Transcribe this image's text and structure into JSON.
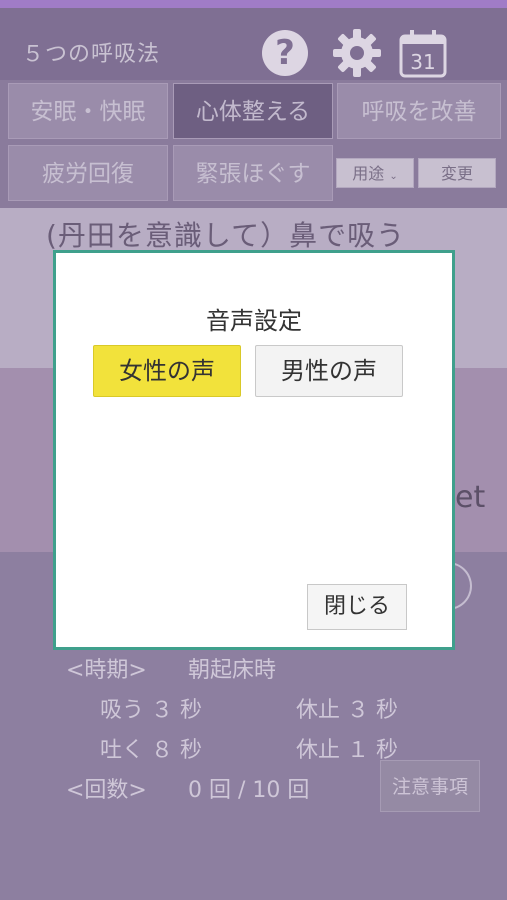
{
  "header": {
    "title": "５つの呼吸法",
    "calendar_day": "31"
  },
  "modes": {
    "row1": [
      "安眠・快眠",
      "心体整える",
      "呼吸を改善"
    ],
    "row2": [
      "疲労回復",
      "緊張ほぐす"
    ],
    "usage_select": "用途",
    "change_button": "変更"
  },
  "instruction": "(丹田を意識して）鼻で吸う",
  "panel_fragment": "et",
  "info": {
    "timing_label": "<時期>",
    "timing_value": "朝起床時",
    "inhale": "吸う ３ 秒",
    "hold1": "休止 ３ 秒",
    "exhale": "吐く ８ 秒",
    "hold2": "休止 １ 秒",
    "count_label": "<回数>",
    "count_value": "0 回 / 10 回",
    "notes_button": "注意事項"
  },
  "modal": {
    "title": "音声設定",
    "female_voice": "女性の声",
    "male_voice": "男性の声",
    "close": "閉じる"
  },
  "colors": {
    "accent_yellow": "#f2e23b",
    "modal_border": "#3fa08c",
    "overlay_purple": "#8d7fa0"
  }
}
